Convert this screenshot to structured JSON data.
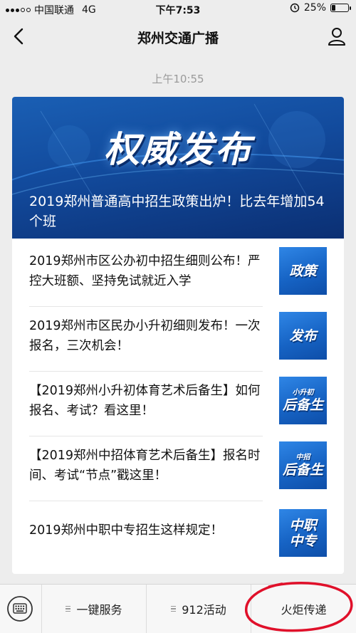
{
  "status_bar": {
    "carrier": "中国联通",
    "network": "4G",
    "time": "下午7:53",
    "battery": "25%",
    "battery_level": 0.25
  },
  "nav": {
    "title": "郑州交通广播"
  },
  "timestamp": "上午10:55",
  "banner": {
    "headline": "权威发布",
    "caption": "2019郑州普通高中招生政策出炉！比去年增加54个班"
  },
  "articles": [
    {
      "title": "2019郑州市区公办初中招生细则公布！严控大班额、坚持免试就近入学",
      "thumb": "政策"
    },
    {
      "title": "2019郑州市区民办小升初细则发布！一次报名，三次机会！",
      "thumb": "发布"
    },
    {
      "title": "【2019郑州小升初体育艺术后备生】如何报名、考试？看这里！",
      "thumb_small": "小升初",
      "thumb": "后备生"
    },
    {
      "title": "【2019郑州中招体育艺术后备生】报名时间、考试“节点”戳这里！",
      "thumb_small": "中招",
      "thumb": "后备生"
    },
    {
      "title": "2019郑州中职中专招生这样规定！",
      "thumb_line1": "中职",
      "thumb_line2": "中专"
    }
  ],
  "bottom_menu": {
    "items": [
      "一键服务",
      "912活动",
      "火炬传递"
    ]
  },
  "colors": {
    "banner_blue": "#124a9c",
    "thumb_blue": "#1663c4",
    "annotation_red": "#e0102a"
  },
  "icons": [
    "signal-icon",
    "battery-icon",
    "alarm-icon",
    "back-arrow-icon",
    "profile-icon",
    "keyboard-icon",
    "menu-list-icon"
  ]
}
